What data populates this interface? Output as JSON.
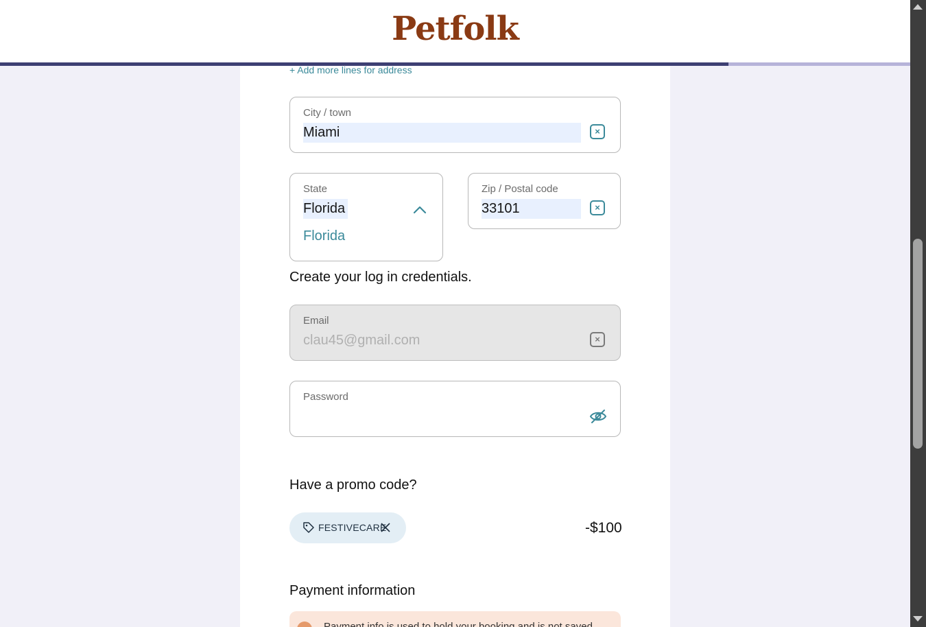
{
  "header": {
    "logo": "Petfolk",
    "progress_fraction": 0.8
  },
  "address": {
    "add_lines_link": "+ Add more lines for address",
    "city": {
      "label": "City / town",
      "value": "Miami"
    },
    "state": {
      "label": "State",
      "value": "Florida",
      "option": "Florida"
    },
    "zip": {
      "label": "Zip / Postal code",
      "value": "33101"
    }
  },
  "credentials": {
    "heading": "Create your log in credentials.",
    "email": {
      "label": "Email",
      "value": "clau45@gmail.com"
    },
    "password": {
      "label": "Password",
      "value": ""
    }
  },
  "promo": {
    "heading": "Have a promo code?",
    "code": "FESTIVECARE",
    "discount": "-$100"
  },
  "payment": {
    "heading": "Payment information",
    "notice": "Payment info is used to hold your booking and is not saved"
  },
  "colors": {
    "accent": "#3b8a9a",
    "brand": "#8a3a14",
    "progress": "#3d3f73"
  }
}
